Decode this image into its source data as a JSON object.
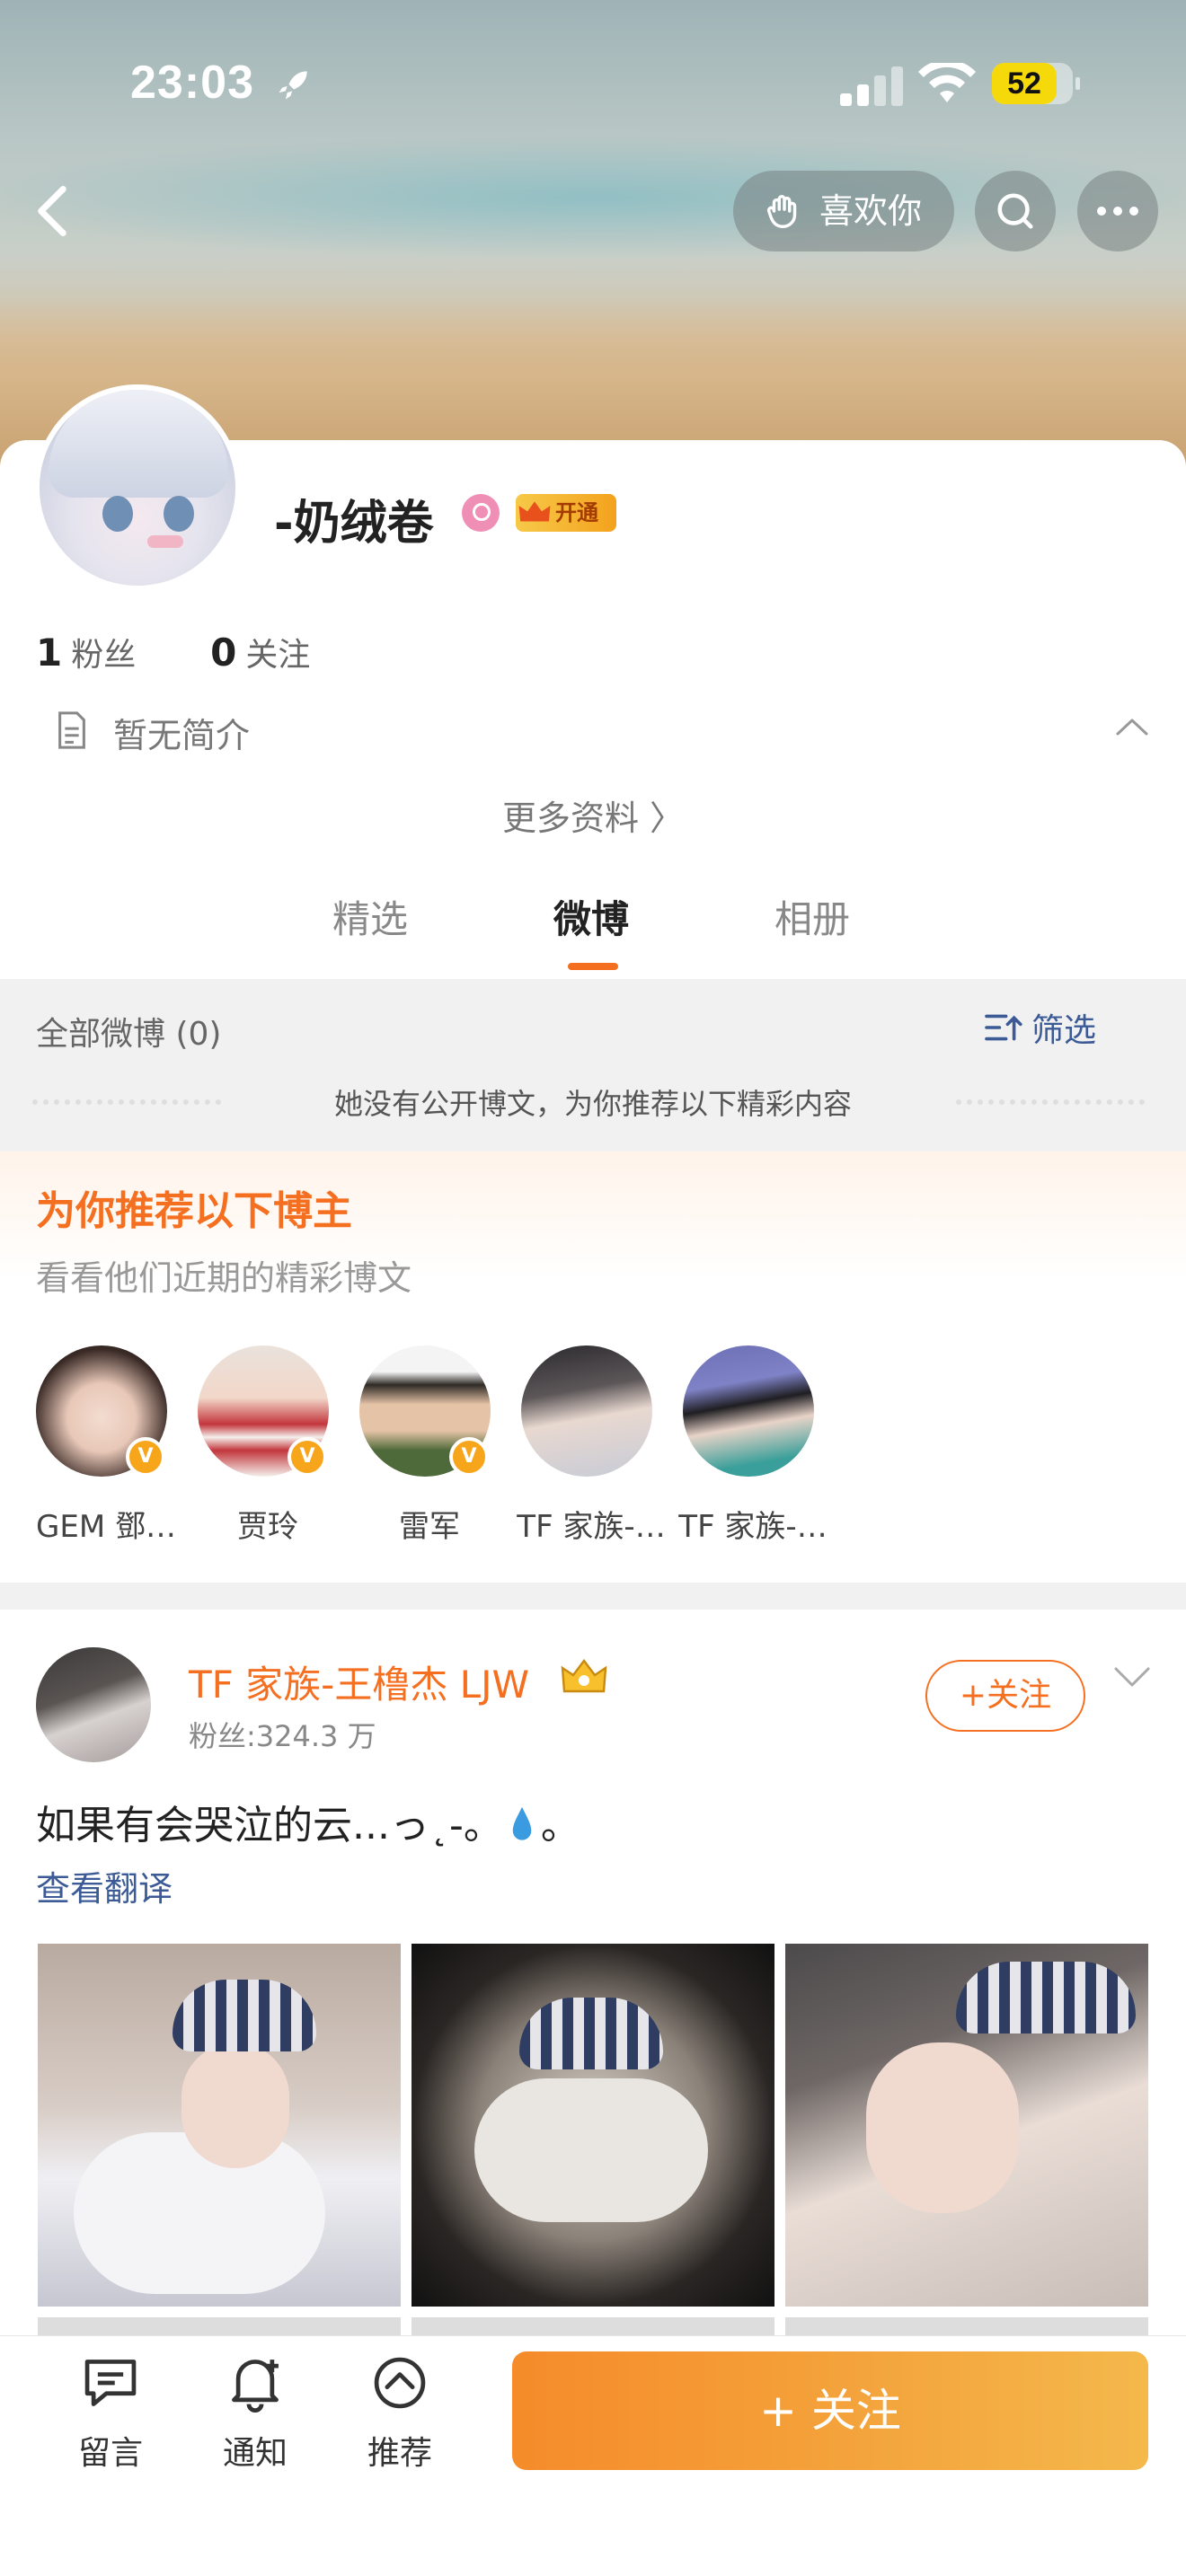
{
  "status_bar": {
    "time": "23:03",
    "battery": "52"
  },
  "header": {
    "like_label": "喜欢你"
  },
  "profile": {
    "nickname": "-奶绒卷",
    "vip_label": "开通",
    "fans_count": "1",
    "fans_label": "粉丝",
    "following_count": "0",
    "following_label": "关注",
    "bio": "暂无简介",
    "more_info": "更多资料 〉"
  },
  "tabs": [
    {
      "label": "精选"
    },
    {
      "label": "微博"
    },
    {
      "label": "相册"
    }
  ],
  "feed": {
    "all_weibo": "全部微博 (0)",
    "filter_label": "筛选",
    "empty_note": "她没有公开博文，为你推荐以下精彩内容"
  },
  "recommend": {
    "title": "为你推荐以下博主",
    "subtitle": "看看他们近期的精彩博文",
    "users": [
      {
        "name": "GEM 鄧…"
      },
      {
        "name": "贾玲"
      },
      {
        "name": "雷军"
      },
      {
        "name": "TF 家族-…"
      },
      {
        "name": "TF 家族-…"
      }
    ]
  },
  "post": {
    "author": "TF 家族-王橹杰 LJW",
    "fans": "粉丝:324.3 万",
    "follow_label": "+关注",
    "text_before": "如果有会哭泣的云...っ˛-。",
    "text_after": "。",
    "translate": "查看翻译"
  },
  "bottom_bar": {
    "comment_label": "留言",
    "notify_label": "通知",
    "recommend_label": "推荐",
    "follow_label": "+ 关注"
  },
  "colors": {
    "accent": "#f56f20",
    "link": "#3b5a96"
  }
}
